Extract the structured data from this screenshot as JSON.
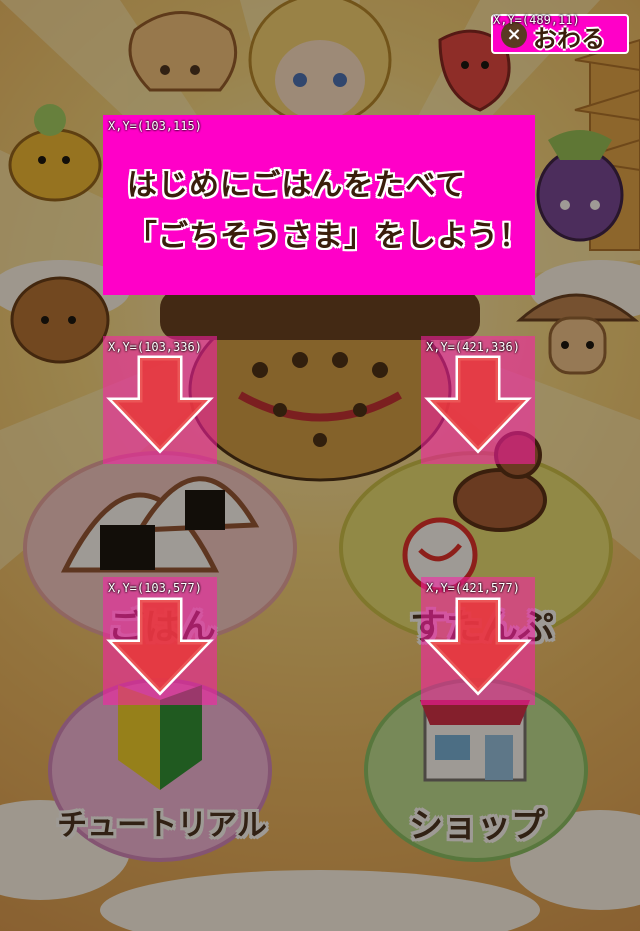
{
  "game": {
    "instruction_line1": "はじめにごはんをたべて",
    "instruction_line2": "「ごちそうさま」をしよう！",
    "title_partial": "ごちそうさま",
    "quit_label": "おわる",
    "quit_icon": "×"
  },
  "menu": {
    "gohan_label": "ごはん",
    "stamp_label": "すたんぷ",
    "tutorial_label": "チュートリアル",
    "shop_label": "ショップ"
  },
  "coordinate_labels": {
    "quit": "X,Y=(489,11)",
    "banner": "X,Y=(103,115)",
    "arrow_gohan": "X,Y=(103,336)",
    "arrow_stamp": "X,Y=(421,336)",
    "arrow_tutorial": "X,Y=(103,577)",
    "arrow_shop": "X,Y=(421,577)"
  },
  "colors": {
    "highlight": "#ff00c8",
    "arrow_red": "#e8383a"
  }
}
